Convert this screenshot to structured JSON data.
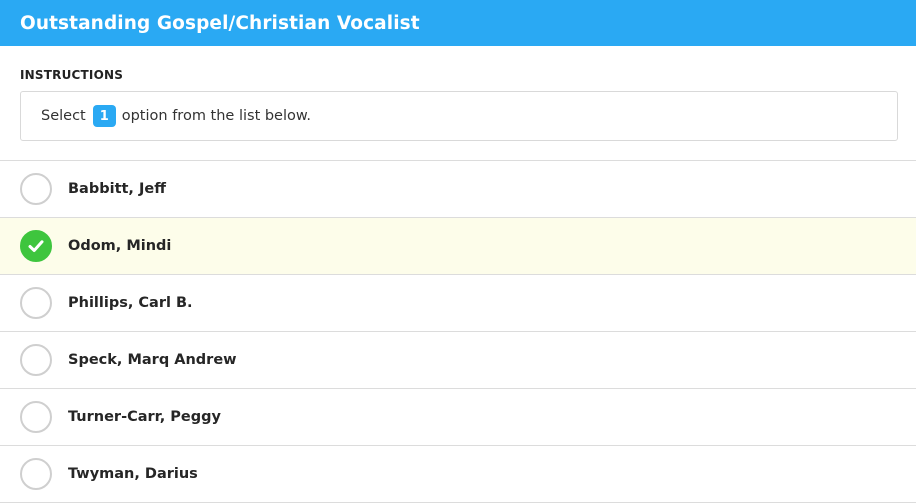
{
  "header": {
    "title": "Outstanding Gospel/Christian Vocalist"
  },
  "instructions": {
    "label": "INSTRUCTIONS",
    "text_before": "Select",
    "count": "1",
    "text_after": "option from the list below."
  },
  "options": [
    {
      "label": "Babbitt, Jeff",
      "selected": false
    },
    {
      "label": "Odom, Mindi",
      "selected": true
    },
    {
      "label": "Phillips, Carl B.",
      "selected": false
    },
    {
      "label": "Speck, Marq Andrew",
      "selected": false
    },
    {
      "label": "Turner-Carr, Peggy",
      "selected": false
    },
    {
      "label": "Twyman, Darius",
      "selected": false
    }
  ],
  "colors": {
    "accent": "#2aa9f3",
    "selected_check": "#3ec53e",
    "selected_row": "#fdfdea"
  },
  "icons": {
    "selected": "check-icon"
  }
}
